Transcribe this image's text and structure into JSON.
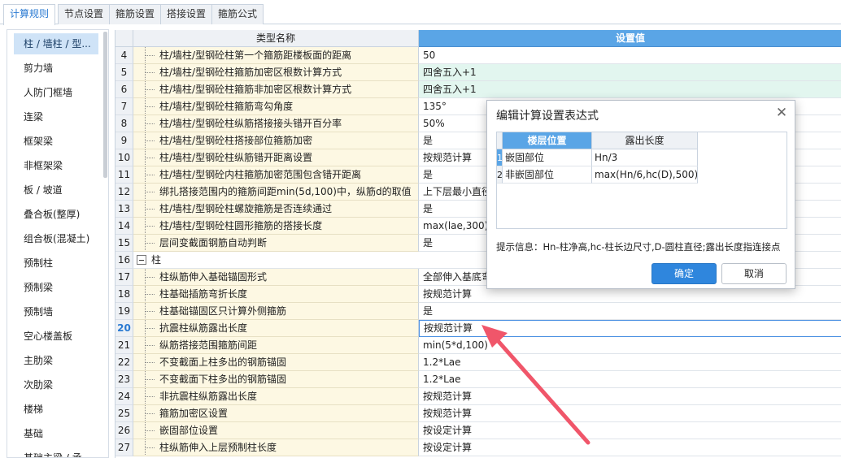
{
  "tabs": [
    {
      "label": "计算规则",
      "active": true
    },
    {
      "label": "节点设置",
      "active": false
    },
    {
      "label": "箍筋设置",
      "active": false
    },
    {
      "label": "搭接设置",
      "active": false
    },
    {
      "label": "箍筋公式",
      "active": false
    }
  ],
  "sidebar": {
    "items": [
      {
        "label": "柱 / 墙柱 / 型...",
        "active": true
      },
      {
        "label": "剪力墙"
      },
      {
        "label": "人防门框墙"
      },
      {
        "label": "连梁"
      },
      {
        "label": "框架梁"
      },
      {
        "label": "非框架梁"
      },
      {
        "label": "板 / 坡道"
      },
      {
        "label": "叠合板(整厚)"
      },
      {
        "label": "组合板(混凝土)"
      },
      {
        "label": "预制柱"
      },
      {
        "label": "预制梁"
      },
      {
        "label": "预制墙"
      },
      {
        "label": "空心楼盖板"
      },
      {
        "label": "主肋梁"
      },
      {
        "label": "次肋梁"
      },
      {
        "label": "楼梯"
      },
      {
        "label": "基础"
      },
      {
        "label": "基础主梁 / 承"
      }
    ]
  },
  "grid": {
    "header_name": "类型名称",
    "header_value": "设置值",
    "rows": [
      {
        "num": "4",
        "name": "柱/墙柱/型钢砼柱第一个箍筋距楼板面的距离",
        "value": "50"
      },
      {
        "num": "5",
        "name": "柱/墙柱/型钢砼柱箍筋加密区根数计算方式",
        "value": "四舍五入+1",
        "green": true
      },
      {
        "num": "6",
        "name": "柱/墙柱/型钢砼柱箍筋非加密区根数计算方式",
        "value": "四舍五入+1",
        "green": true
      },
      {
        "num": "7",
        "name": "柱/墙柱/型钢砼柱箍筋弯勾角度",
        "value": "135°"
      },
      {
        "num": "8",
        "name": "柱/墙柱/型钢砼柱纵筋搭接接头错开百分率",
        "value": "50%"
      },
      {
        "num": "9",
        "name": "柱/墙柱/型钢砼柱搭接部位箍筋加密",
        "value": "是"
      },
      {
        "num": "10",
        "name": "柱/墙柱/型钢砼柱纵筋错开距离设置",
        "value": "按规范计算"
      },
      {
        "num": "11",
        "name": "柱/墙柱/型钢砼内柱箍筋加密范围包含错开距离",
        "value": "是"
      },
      {
        "num": "12",
        "name": "绑扎搭接范围内的箍筋间距min(5d,100)中，纵筋d的取值",
        "value": "上下层最小直径"
      },
      {
        "num": "13",
        "name": "柱/墙柱/型钢砼柱螺旋箍筋是否连续通过",
        "value": "是"
      },
      {
        "num": "14",
        "name": "柱/墙柱/型钢砼柱圆形箍筋的搭接长度",
        "value": "max(lae,300)"
      },
      {
        "num": "15",
        "name": "层间变截面钢筋自动判断",
        "value": "是"
      },
      {
        "num": "16",
        "group": "柱"
      },
      {
        "num": "17",
        "name": "柱纵筋伸入基础锚固形式",
        "value": "全部伸入基底弯折"
      },
      {
        "num": "18",
        "name": "柱基础插筋弯折长度",
        "value": "按规范计算"
      },
      {
        "num": "19",
        "name": "柱基础锚固区只计算外侧箍筋",
        "value": "是"
      },
      {
        "num": "20",
        "name": "抗震柱纵筋露出长度",
        "value": "按规范计算",
        "focus": true
      },
      {
        "num": "21",
        "name": "纵筋搭接范围箍筋间距",
        "value": "min(5*d,100)"
      },
      {
        "num": "22",
        "name": "不变截面上柱多出的钢筋锚固",
        "value": "1.2*Lae"
      },
      {
        "num": "23",
        "name": "不变截面下柱多出的钢筋锚固",
        "value": "1.2*Lae"
      },
      {
        "num": "24",
        "name": "非抗震柱纵筋露出长度",
        "value": "按规范计算"
      },
      {
        "num": "25",
        "name": "箍筋加密区设置",
        "value": "按规范计算"
      },
      {
        "num": "26",
        "name": "嵌固部位设置",
        "value": "按设定计算"
      },
      {
        "num": "27",
        "name": "柱纵筋伸入上层预制柱长度",
        "value": "按设定计算"
      }
    ]
  },
  "dialog": {
    "title": "编辑计算设置表达式",
    "close_glyph": "✕",
    "col1": "楼层位置",
    "col2": "露出长度",
    "rows": [
      {
        "num": "1",
        "pos": "嵌固部位",
        "len": "Hn/3"
      },
      {
        "num": "2",
        "pos": "非嵌固部位",
        "len": "max(Hn/6,hc(D),500)"
      }
    ],
    "hint": "提示信息：Hn-柱净高,hc-柱长边尺寸,D-圆柱直径;露出长度指连接点",
    "ok": "确定",
    "cancel": "取消"
  },
  "colors": {
    "accent": "#2f86dd",
    "header_value_bg": "#5aa5e6",
    "name_cell_bg": "#fdf8e3",
    "green_value_bg": "#e2f6ef",
    "arrow": "#f0566a"
  }
}
